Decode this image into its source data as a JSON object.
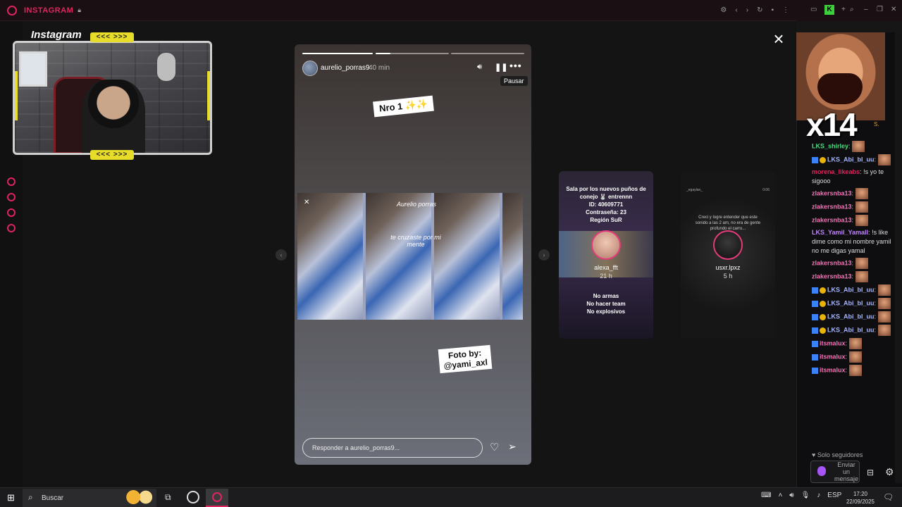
{
  "browser": {
    "title": "INSTAGRAM",
    "lock_icon": "lock-icon"
  },
  "overlay": {
    "label": "Instagram",
    "chevrons": "<<< >>>"
  },
  "story": {
    "username": "aurelio_porras9",
    "time": "40 min",
    "tooltip": "Pausar",
    "sticker_nro": "Nro 1 ✨✨",
    "collage_name": "Aurelio porras",
    "collage_text": "te cruzaste por mi mente",
    "sticker_foto_line1": "Foto by:",
    "sticker_foto_line2": "@yami_axl",
    "reply_placeholder": "Responder a aurelio_porras9...",
    "progress": [
      1.0,
      0.2,
      0.0
    ]
  },
  "previews": [
    {
      "name": "alexa_fft",
      "time": "21 h",
      "header": "Sala por los nuevos puños de conejo 🐰 entrennn\nID: 40609771\nContraseña: 23\nRegión SuR",
      "rules": "No armas\nNo hacer team\nNo explosivos"
    },
    {
      "name": "usxr.lpxz",
      "time": "5 h",
      "top_left": "_egaylan_",
      "top_right": "0:06",
      "header": "Creci y logre entender que este sonido a las 2 am, no era de gente profundo el carro..."
    }
  ],
  "chat": {
    "overlay_text": "x14",
    "tag": "S.",
    "messages": [
      {
        "user": "LKS_shirley",
        "color": "#4ade80",
        "text": "",
        "emote": true,
        "badges": 0
      },
      {
        "user": "LKS_Abi_bl_uu",
        "color": "#a5b4fc",
        "text": "",
        "emote": true,
        "badges": 2
      },
      {
        "user": "morena_likeabs",
        "color": "#e0245e",
        "text": "!s yo te sigooo",
        "emote": false,
        "badges": 0
      },
      {
        "user": "zlakersnba13",
        "color": "#f472b6",
        "text": "",
        "emote": true,
        "badges": 0
      },
      {
        "user": "zlakersnba13",
        "color": "#f472b6",
        "text": "",
        "emote": true,
        "badges": 0
      },
      {
        "user": "zlakersnba13",
        "color": "#f472b6",
        "text": "",
        "emote": true,
        "badges": 0
      },
      {
        "user": "LKS_Yamil_Yamall",
        "color": "#c084fc",
        "text": "!s like dime como mi nombre yamil no me digas yamal",
        "emote": false,
        "badges": 0
      },
      {
        "user": "zlakersnba13",
        "color": "#f472b6",
        "text": "",
        "emote": true,
        "badges": 0
      },
      {
        "user": "zlakersnba13",
        "color": "#f472b6",
        "text": "",
        "emote": true,
        "badges": 0
      },
      {
        "user": "LKS_Abi_bl_uu",
        "color": "#a5b4fc",
        "text": "",
        "emote": true,
        "badges": 2
      },
      {
        "user": "LKS_Abi_bl_uu",
        "color": "#a5b4fc",
        "text": "",
        "emote": true,
        "badges": 2
      },
      {
        "user": "LKS_Abi_bl_uu",
        "color": "#a5b4fc",
        "text": "",
        "emote": true,
        "badges": 2
      },
      {
        "user": "LKS_Abi_bl_uu",
        "color": "#a5b4fc",
        "text": "",
        "emote": true,
        "badges": 2
      },
      {
        "user": "itsmalux",
        "color": "#f472b6",
        "text": "",
        "emote": true,
        "badges": 1
      },
      {
        "user": "itsmalux",
        "color": "#f472b6",
        "text": "",
        "emote": true,
        "badges": 1
      },
      {
        "user": "itsmalux",
        "color": "#f472b6",
        "text": "",
        "emote": true,
        "badges": 1
      }
    ],
    "followers_label": "Solo seguidores",
    "input_placeholder": "Enviar un mensaje"
  },
  "taskbar": {
    "search_label": "Buscar",
    "lang": "ESP",
    "time": "17:20",
    "date": "22/09/2025"
  },
  "colors": {
    "accent": "#e0245e",
    "overlay_yellow": "#e7dc2a"
  }
}
